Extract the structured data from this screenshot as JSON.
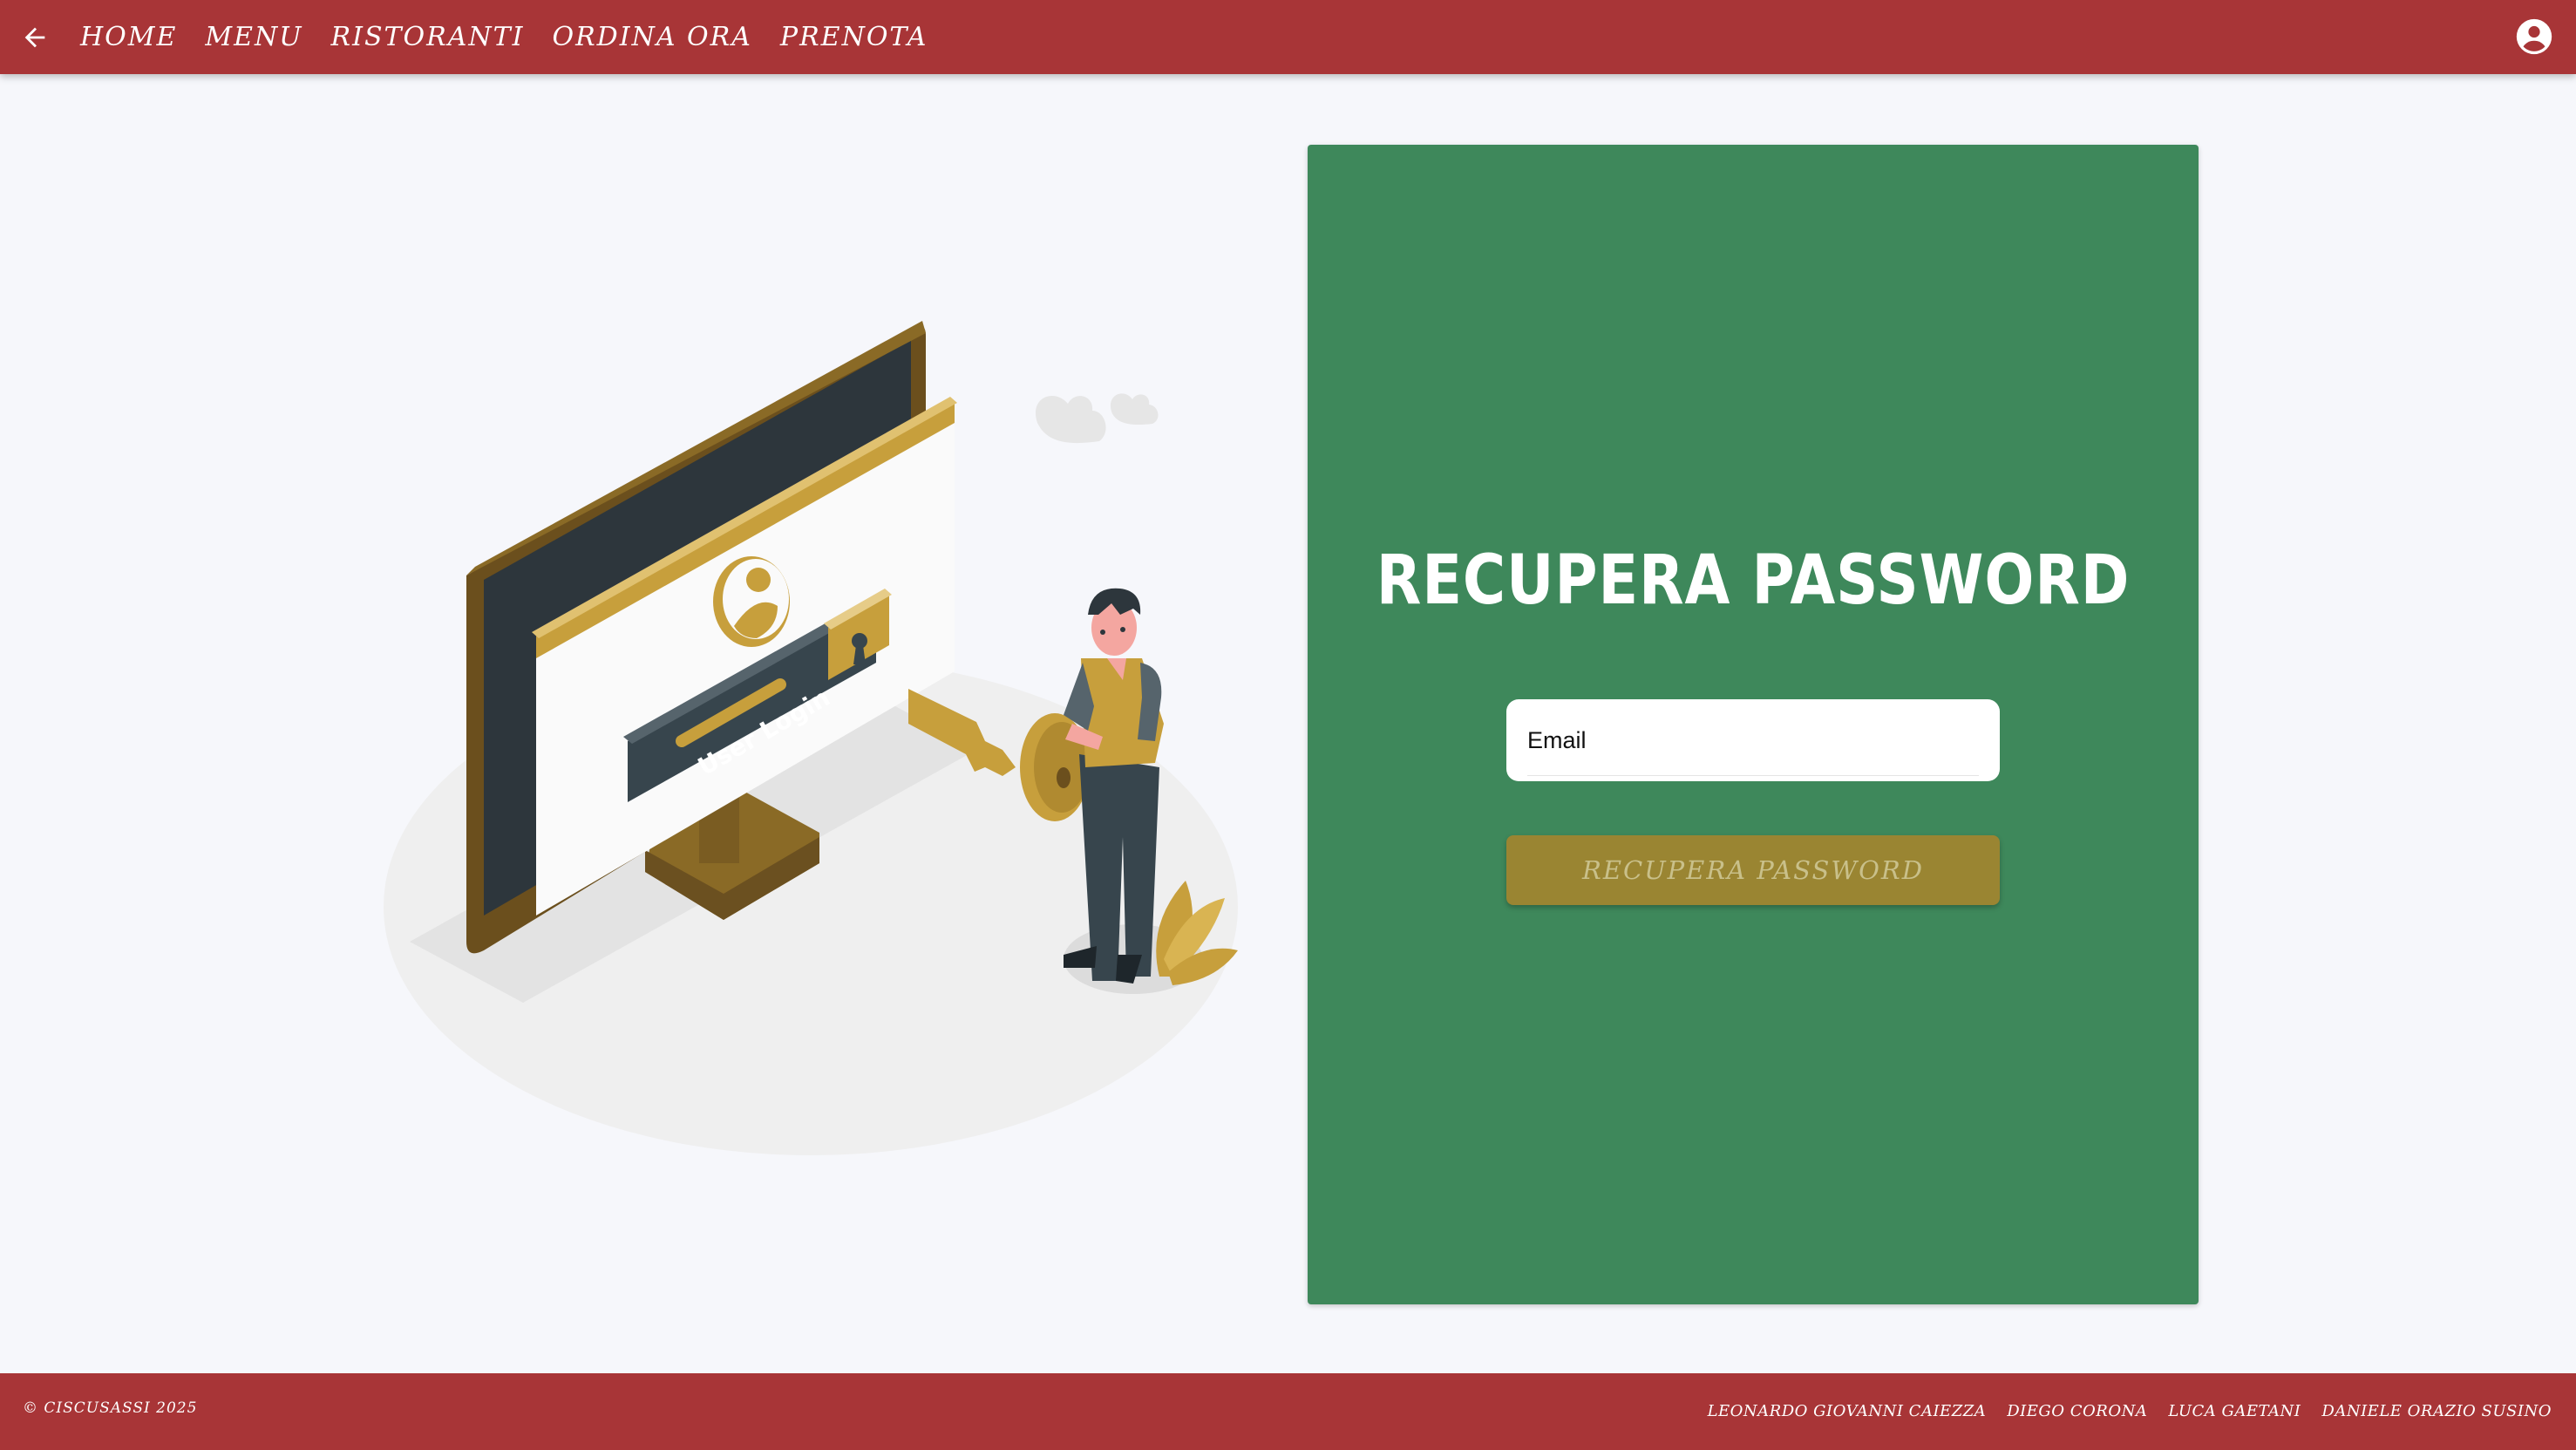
{
  "nav": {
    "items": [
      "HOME",
      "MENU",
      "RISTORANTI",
      "ORDINA ORA",
      "PRENOTA"
    ],
    "back_icon": "arrow-left-icon",
    "account_icon": "account-circle-icon"
  },
  "illustration": {
    "label": "User Login"
  },
  "form": {
    "title": "RECUPERA PASSWORD",
    "email_placeholder": "Email",
    "email_value": "",
    "submit_label": "RECUPERA PASSWORD"
  },
  "footer": {
    "copyright": "© CISCUSASSI 2025",
    "authors": [
      "LEONARDO GIOVANNI CAIEZZA",
      "DIEGO CORONA",
      "LUCA GAETANI",
      "DANIELE ORAZIO SUSINO"
    ]
  },
  "colors": {
    "header": "#a83537",
    "card": "#3e885b",
    "button": "#9a8532",
    "background": "#f6f7fb"
  }
}
